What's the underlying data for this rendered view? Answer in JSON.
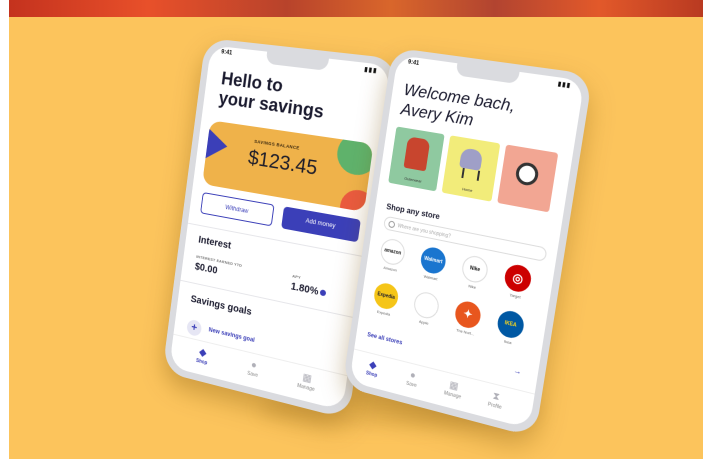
{
  "colors": {
    "background": "#fcc45c",
    "accent": "#3b3fb8",
    "card": "#efb24a"
  },
  "phone_left": {
    "status_time": "9:41",
    "title_line1": "Hello to",
    "title_line2": "your savings",
    "balance_label": "SAVINGS BALANCE",
    "balance_value": "$123.45",
    "withdraw_label": "Withdraw",
    "add_money_label": "Add money",
    "interest_heading": "Interest",
    "interest_earned_label": "INTEREST EARNED YTD",
    "interest_earned_value": "$0.00",
    "apy_label": "APY",
    "apy_value": "1.80%",
    "goals_heading": "Savings goals",
    "new_goal_label": "New savings goal",
    "tabs": [
      {
        "label": "Shop",
        "icon": "diamond-icon"
      },
      {
        "label": "Save",
        "icon": "circle-icon"
      },
      {
        "label": "Manage",
        "icon": "grid-icon"
      }
    ]
  },
  "phone_right": {
    "status_time": "9:41",
    "title_line1": "Welcome bach,",
    "title_line2": "Avery Kim",
    "tiles": [
      {
        "label": "Outerwear"
      },
      {
        "label": "Home"
      },
      {
        "label": ""
      }
    ],
    "shop_heading": "Shop any store",
    "search_placeholder": "Where are you shopping?",
    "stores": [
      {
        "logo": "amazon",
        "name": "Amazon"
      },
      {
        "logo": "Walmart",
        "name": "Walmart"
      },
      {
        "logo": "Nike",
        "name": "Nike"
      },
      {
        "logo": "◎",
        "name": "Target"
      },
      {
        "logo": "Expedia",
        "name": "Expedia"
      },
      {
        "logo": "",
        "name": "Apple"
      },
      {
        "logo": "✦",
        "name": "The Nort..."
      },
      {
        "logo": "IKEA",
        "name": "Ikea"
      }
    ],
    "see_all_label": "See all stores",
    "tabs": [
      {
        "label": "Shop",
        "icon": "diamond-icon"
      },
      {
        "label": "Save",
        "icon": "circle-icon"
      },
      {
        "label": "Manage",
        "icon": "grid-icon"
      },
      {
        "label": "Profile",
        "icon": "hourglass-icon"
      }
    ]
  }
}
